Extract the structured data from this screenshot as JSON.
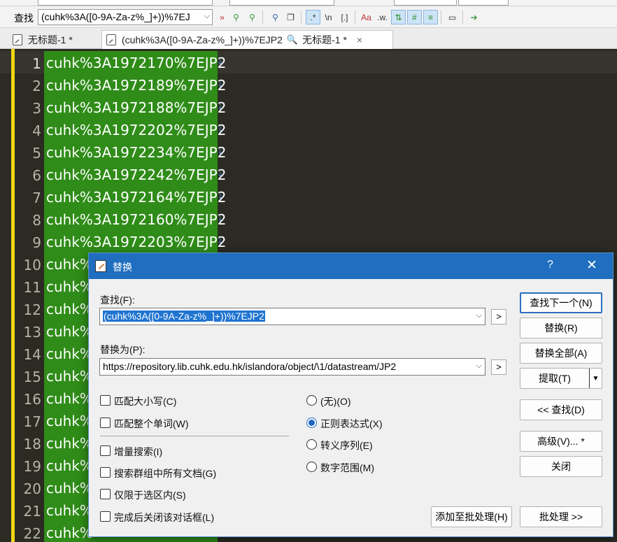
{
  "findbar": {
    "label": "查找",
    "value": "(cuhk%3A([0-9A-Za-z%_]+))%7EJ"
  },
  "tabs": [
    {
      "label": "无标题-1 *"
    },
    {
      "label": "(cuhk%3A([0-9A-Za-z%_]+))%7EJP2",
      "label2": "无标题-1 *",
      "close": "×"
    }
  ],
  "editor": {
    "lines": [
      {
        "num": "1",
        "text": "cuhk%3A1972170%7EJP2"
      },
      {
        "num": "2",
        "text": "cuhk%3A1972189%7EJP2"
      },
      {
        "num": "3",
        "text": "cuhk%3A1972188%7EJP2"
      },
      {
        "num": "4",
        "text": "cuhk%3A1972202%7EJP2"
      },
      {
        "num": "5",
        "text": "cuhk%3A1972234%7EJP2"
      },
      {
        "num": "6",
        "text": "cuhk%3A1972242%7EJP2"
      },
      {
        "num": "7",
        "text": "cuhk%3A1972164%7EJP2"
      },
      {
        "num": "8",
        "text": "cuhk%3A1972160%7EJP2"
      },
      {
        "num": "9",
        "text": "cuhk%3A1972203%7EJP2"
      },
      {
        "num": "10",
        "text": "cuhk%"
      },
      {
        "num": "11",
        "text": "cuhk%"
      },
      {
        "num": "12",
        "text": "cuhk%"
      },
      {
        "num": "13",
        "text": "cuhk%"
      },
      {
        "num": "14",
        "text": "cuhk%"
      },
      {
        "num": "15",
        "text": "cuhk%"
      },
      {
        "num": "16",
        "text": "cuhk%"
      },
      {
        "num": "17",
        "text": "cuhk%"
      },
      {
        "num": "18",
        "text": "cuhk%"
      },
      {
        "num": "19",
        "text": "cuhk%"
      },
      {
        "num": "20",
        "text": "cuhk%"
      },
      {
        "num": "21",
        "text": "cuhk%"
      },
      {
        "num": "22",
        "text": "cuhk%"
      }
    ],
    "eol_glyph": "↓"
  },
  "dialog": {
    "title": "替换",
    "help": "?",
    "close": "✕",
    "find_label": "查找(F):",
    "find_value": "(cuhk%3A([0-9A-Za-z%_]+))%7EJP2",
    "replace_label": "替换为(P):",
    "replace_value": "https://repository.lib.cuhk.edu.hk/islandora/object/\\1/datastream/JP2",
    "expand": ">",
    "checkboxes": {
      "match_case": "匹配大小写(C)",
      "whole_word": "匹配整个单词(W)",
      "incremental": "增量搜索(I)",
      "all_docs": "搜索群组中所有文档(G)",
      "in_selection": "仅限于选区内(S)",
      "close_after": "完成后关闭该对话框(L)"
    },
    "radios": {
      "none": "(无)(O)",
      "regex": "正则表达式(X)",
      "escape": "转义序列(E)",
      "numrange": "数字范围(M)"
    },
    "buttons": {
      "find_next": "查找下一个(N)",
      "replace": "替换(R)",
      "replace_all": "替换全部(A)",
      "extract": "提取(T)",
      "find_back": "<< 查找(D)",
      "advanced": "高级(V)... *",
      "close": "关闭",
      "add_batch": "添加至批处理(H)",
      "batch": "批处理 >>"
    }
  }
}
